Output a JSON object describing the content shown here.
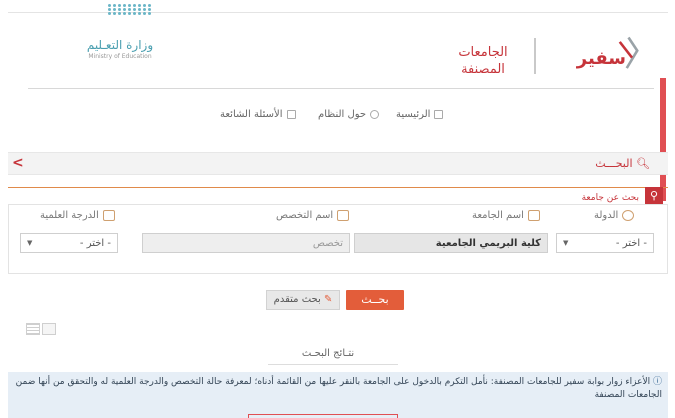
{
  "header": {
    "ministry_name": "وزارة التعـليم",
    "ministry_sub": "Ministry of Education",
    "brand_logo_text": "سفير",
    "page_title_line1": "الجامعات",
    "page_title_line2": "المصنفة"
  },
  "nav": {
    "home": "الرئيسية",
    "about": "حول النظام",
    "faq": "الأسئلة الشائعة"
  },
  "search_bar": {
    "title": "البحـــث",
    "collapse_glyph": "<"
  },
  "university_search": {
    "label": "بحث عن جامعة"
  },
  "fields": {
    "country_label": "الدولة",
    "country_value": "- اختر -",
    "university_label": "اسم الجامعة",
    "university_value": "كلية البريمي الجامعية",
    "specialty_label": "اسم التخصص",
    "specialty_placeholder": "تخصص",
    "degree_label": "الدرجة العلمية",
    "degree_value": "- اختر -"
  },
  "buttons": {
    "search": "بحــث",
    "advanced": "بحث متقدم"
  },
  "results": {
    "label": "نتـائج البحـث"
  },
  "notice": {
    "text": "الأعزاء زوار بوابة سفير للجامعات المصنفة: نأمل التكرم بالدخول على الجامعة بالنقر عليها من القائمة أدناه؛ لمعرفة حالة التخصص والدرجة العلمية له والتحقق من أنها ضمن الجامعات المصنفة"
  },
  "colors": {
    "brand_red": "#c6343a",
    "accent_orange": "#e35d3a",
    "moe_teal": "#4a9fb0"
  }
}
